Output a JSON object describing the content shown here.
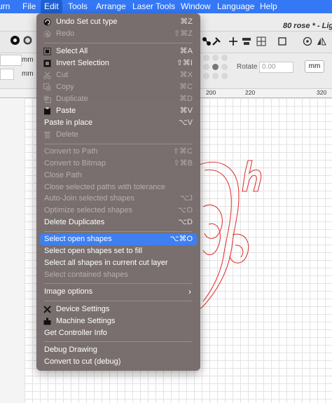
{
  "menubar": {
    "items": [
      {
        "label": "urn"
      },
      {
        "label": "File"
      },
      {
        "label": "Edit"
      },
      {
        "label": "Tools"
      },
      {
        "label": "Arrange"
      },
      {
        "label": "Laser Tools"
      },
      {
        "label": "Window"
      },
      {
        "label": "Language"
      },
      {
        "label": "Help"
      }
    ]
  },
  "window": {
    "title": "80 rose * - Lig"
  },
  "toolbar": {
    "units": [
      "mm",
      "mm"
    ],
    "rotate_label": "Rotate",
    "rotate_value": "0.00",
    "unit_button": "mm"
  },
  "ruler": {
    "ticks": [
      "200",
      "220",
      "320"
    ]
  },
  "edit_menu": {
    "items": [
      {
        "label": "Undo Set cut type",
        "shortcut": "⌘Z",
        "enabled": true,
        "icon": "undo-icon"
      },
      {
        "label": "Redo",
        "shortcut": "⇧⌘Z",
        "enabled": false,
        "icon": "redo-icon"
      },
      {
        "label": "Select All",
        "shortcut": "⌘A",
        "enabled": true,
        "icon": "select-all-icon"
      },
      {
        "label": "Invert Selection",
        "shortcut": "⇧⌘I",
        "enabled": true,
        "icon": "invert-selection-icon"
      },
      {
        "label": "Cut",
        "shortcut": "⌘X",
        "enabled": false,
        "icon": "scissors-icon"
      },
      {
        "label": "Copy",
        "shortcut": "⌘C",
        "enabled": false,
        "icon": "copy-icon"
      },
      {
        "label": "Duplicate",
        "shortcut": "⌘D",
        "enabled": false,
        "icon": "duplicate-icon"
      },
      {
        "label": "Paste",
        "shortcut": "⌘V",
        "enabled": true,
        "icon": "paste-icon"
      },
      {
        "label": "Paste in place",
        "shortcut": "⌥V",
        "enabled": true
      },
      {
        "label": "Delete",
        "shortcut": "",
        "enabled": false,
        "icon": "trash-icon"
      },
      {
        "label": "Convert to Path",
        "shortcut": "⇧⌘C",
        "enabled": false
      },
      {
        "label": "Convert to Bitmap",
        "shortcut": "⇧⌘B",
        "enabled": false
      },
      {
        "label": "Close Path",
        "shortcut": "",
        "enabled": false
      },
      {
        "label": "Close selected paths with tolerance",
        "shortcut": "",
        "enabled": false
      },
      {
        "label": "Auto-Join selected shapes",
        "shortcut": "⌥J",
        "enabled": false
      },
      {
        "label": "Optimize selected shapes",
        "shortcut": "⌥O",
        "enabled": false
      },
      {
        "label": "Delete Duplicates",
        "shortcut": "⌥D",
        "enabled": true
      },
      {
        "label": "Select open shapes",
        "shortcut": "⌥⌘O",
        "enabled": true,
        "highlighted": true
      },
      {
        "label": "Select open shapes set to fill",
        "shortcut": "",
        "enabled": true
      },
      {
        "label": "Select all shapes in current cut layer",
        "shortcut": "",
        "enabled": true
      },
      {
        "label": "Select contained shapes",
        "shortcut": "",
        "enabled": false
      },
      {
        "label": "Image options",
        "shortcut": "",
        "enabled": true,
        "submenu": true
      },
      {
        "label": "Device Settings",
        "shortcut": "",
        "enabled": true,
        "icon": "tools-icon"
      },
      {
        "label": "Machine Settings",
        "shortcut": "",
        "enabled": true,
        "icon": "machine-icon"
      },
      {
        "label": "Get Controller Info",
        "shortcut": "",
        "enabled": true
      },
      {
        "label": "Debug Drawing",
        "shortcut": "",
        "enabled": true
      },
      {
        "label": "Convert to cut (debug)",
        "shortcut": "",
        "enabled": true
      }
    ]
  },
  "colors": {
    "accent": "#3478f6",
    "menu_bg": "#706464",
    "highlight": "#3f7ff0",
    "cut_red": "#e03a3a"
  }
}
